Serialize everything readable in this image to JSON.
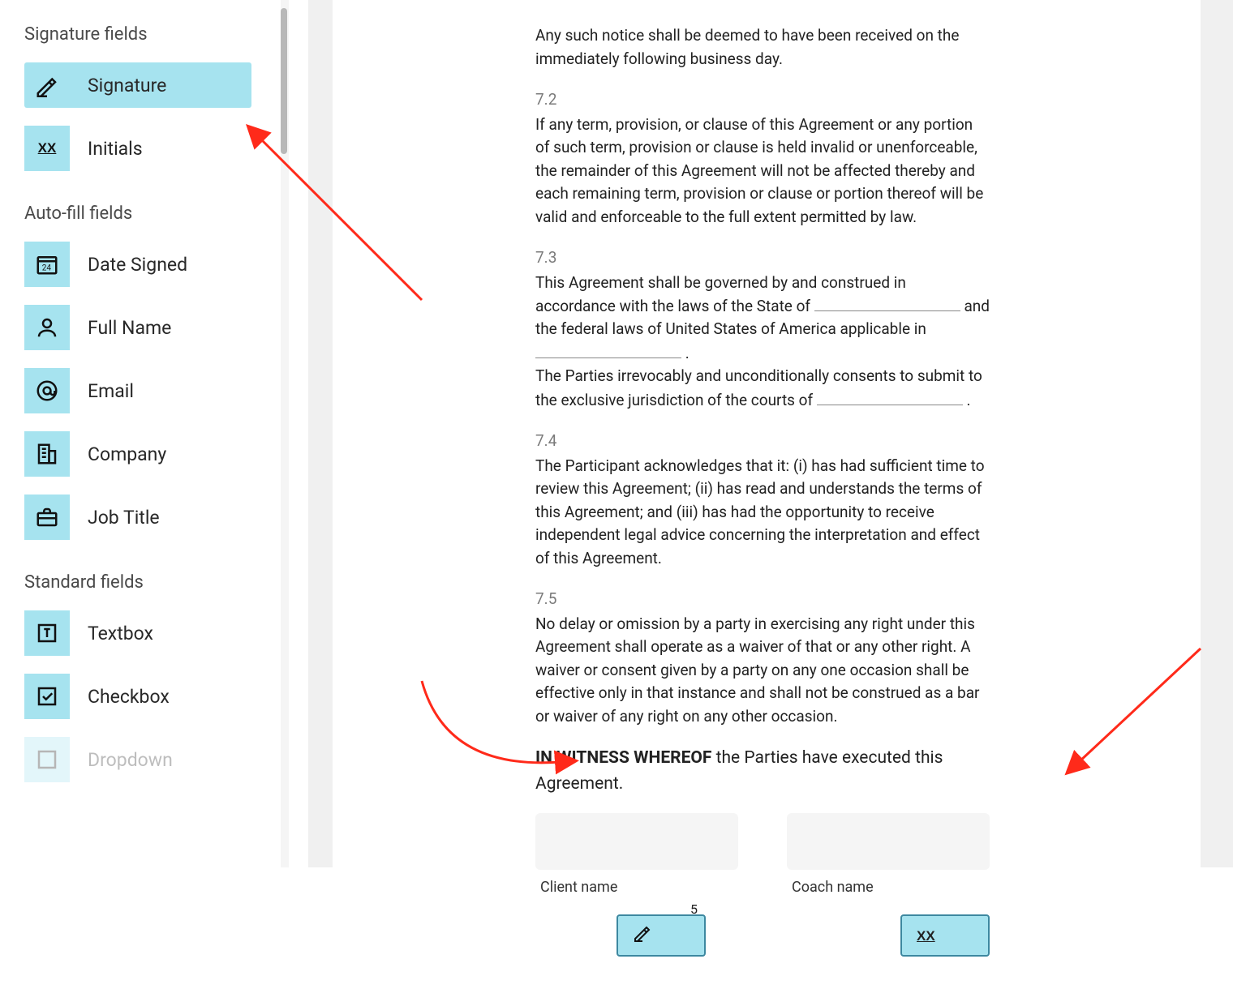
{
  "sidebar": {
    "sections": [
      {
        "title": "Signature fields",
        "items": [
          {
            "icon": "signature-icon",
            "label": "Signature",
            "selected": true
          },
          {
            "icon": "initials-icon",
            "label": "Initials"
          }
        ]
      },
      {
        "title": "Auto-fill fields",
        "items": [
          {
            "icon": "date-signed-icon",
            "label": "Date Signed"
          },
          {
            "icon": "full-name-icon",
            "label": "Full Name"
          },
          {
            "icon": "email-icon",
            "label": "Email"
          },
          {
            "icon": "company-icon",
            "label": "Company"
          },
          {
            "icon": "job-title-icon",
            "label": "Job Title"
          }
        ]
      },
      {
        "title": "Standard fields",
        "items": [
          {
            "icon": "textbox-icon",
            "label": "Textbox"
          },
          {
            "icon": "checkbox-icon",
            "label": "Checkbox"
          },
          {
            "icon": "dropdown-icon",
            "label": "Dropdown"
          }
        ]
      }
    ]
  },
  "document": {
    "intro_paragraph": "Any such notice shall be deemed to have been received on the immediately following business day.",
    "clauses": [
      {
        "num": "7.2",
        "text": "If any term, provision, or clause of this Agreement or any portion of such term, provision or clause is held invalid or unenforceable, the remainder of this Agreement will not be affected thereby and each remaining term, provision or clause or portion thereof will be valid and enforceable to the full extent permitted by law."
      },
      {
        "num": "7.3",
        "part1": "This Agreement shall be governed by and construed in accordance with the laws of the State of ",
        "part2": " and the federal laws of United States of America applicable in ",
        "part3": " .",
        "line2a": "The Parties irrevocably and unconditionally consents to submit to the exclusive jurisdiction of the courts of ",
        "line2b": " ."
      },
      {
        "num": "7.4",
        "text": "The Participant acknowledges that it: (i) has had sufficient time to review this Agreement; (ii) has read and understands the terms of this Agreement; and (iii) has had the opportunity to receive independent legal advice concerning the interpretation and effect of this Agreement."
      },
      {
        "num": "7.5",
        "text": "No delay or omission by a party in exercising any right under this Agreement shall operate as a waiver of that or any other right. A waiver or consent given by a party on any one occasion shall be effective only in that instance and shall not be construed as a bar or waiver of any right on any other occasion."
      }
    ],
    "witness_strong": "IN WITNESS WHEREOF",
    "witness_rest": " the Parties have executed this Agreement.",
    "sig_left_caption": "Client name",
    "sig_right_caption": "Coach name",
    "page_num": "5"
  }
}
